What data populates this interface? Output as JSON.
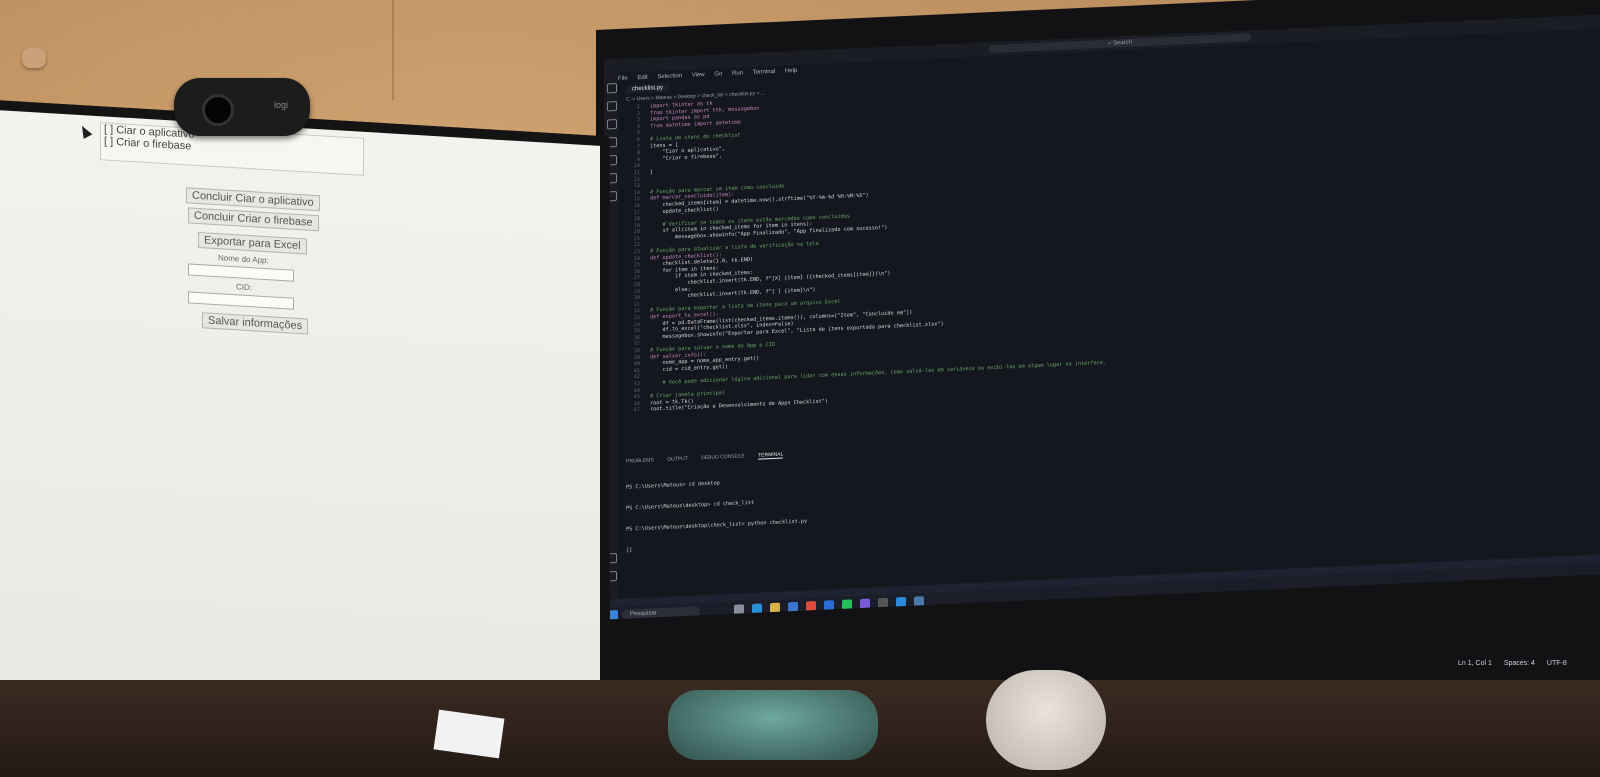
{
  "left_app": {
    "checklist_items": [
      "[ ] Ciar o aplicativo",
      "[ ] Criar o firebase"
    ],
    "btn_concluir_1": "Concluir Ciar o aplicativo",
    "btn_concluir_2": "Concluir Criar o firebase",
    "btn_exportar": "Exportar para Excel",
    "label_nome_app": "Nome do App:",
    "label_cid": "CID:",
    "btn_salvar": "Salvar informações"
  },
  "webcam": {
    "brand": "logi"
  },
  "vscode": {
    "search_placeholder": "Search",
    "menu": [
      "File",
      "Edit",
      "Selection",
      "View",
      "Go",
      "Run",
      "Terminal",
      "Help"
    ],
    "tab": "checklist.py",
    "breadcrumb": "C: > Users > Mateus > Desktop > check_list > checklist.py > ...",
    "code_lines": [
      {
        "n": "1",
        "t": "import tkinter as tk"
      },
      {
        "n": "2",
        "t": "from tkinter import ttk, messagebox"
      },
      {
        "n": "3",
        "t": "import pandas as pd"
      },
      {
        "n": "4",
        "t": "from datetime import datetime"
      },
      {
        "n": "5",
        "t": ""
      },
      {
        "n": "6",
        "t": "# Lista de itens do checklist"
      },
      {
        "n": "7",
        "t": "itens = ["
      },
      {
        "n": "8",
        "t": "    \"Ciar o aplicativo\","
      },
      {
        "n": "9",
        "t": "    \"Criar o firebase\","
      },
      {
        "n": "10",
        "t": ""
      },
      {
        "n": "11",
        "t": "]"
      },
      {
        "n": "12",
        "t": ""
      },
      {
        "n": "13",
        "t": ""
      },
      {
        "n": "14",
        "t": "# Função para marcar um item como concluído"
      },
      {
        "n": "15",
        "t": "def marcar_concluido(item):"
      },
      {
        "n": "16",
        "t": "    checked_items[item] = datetime.now().strftime(\"%Y-%m-%d %H:%M:%S\")"
      },
      {
        "n": "17",
        "t": "    update_checklist()"
      },
      {
        "n": "18",
        "t": ""
      },
      {
        "n": "19",
        "t": "    # Verificar se todos os itens estão marcados como concluídos"
      },
      {
        "n": "20",
        "t": "    if all(item in checked_items for item in itens):"
      },
      {
        "n": "21",
        "t": "        messagebox.showinfo(\"App Finalizado\", \"App finalizado com sucesso!\")"
      },
      {
        "n": "22",
        "t": ""
      },
      {
        "n": "23",
        "t": "# Função para atualizar a lista de verificação na tela"
      },
      {
        "n": "24",
        "t": "def update_checklist():"
      },
      {
        "n": "25",
        "t": "    checklist.delete(1.0, tk.END)"
      },
      {
        "n": "26",
        "t": "    for item in itens:"
      },
      {
        "n": "27",
        "t": "        if item in checked_items:"
      },
      {
        "n": "28",
        "t": "            checklist.insert(tk.END, f\"[X] {item} ({checked_items[item]})\\n\")"
      },
      {
        "n": "29",
        "t": "        else:"
      },
      {
        "n": "30",
        "t": "            checklist.insert(tk.END, f\"[ ] {item}\\n\")"
      },
      {
        "n": "31",
        "t": ""
      },
      {
        "n": "32",
        "t": "# Função para exportar a lista de itens para um arquivo Excel"
      },
      {
        "n": "33",
        "t": "def export_to_excel():"
      },
      {
        "n": "34",
        "t": "    df = pd.DataFrame(list(checked_items.items()), columns=[\"Item\", \"Concluído em\"])"
      },
      {
        "n": "35",
        "t": "    df.to_excel(\"checklist.xlsx\", index=False)"
      },
      {
        "n": "36",
        "t": "    messagebox.showinfo(\"Exportar para Excel\", \"Lista de itens exportada para checklist.xlsx\")"
      },
      {
        "n": "37",
        "t": ""
      },
      {
        "n": "38",
        "t": "# Função para salvar o nome do App e CID"
      },
      {
        "n": "39",
        "t": "def salvar_info():"
      },
      {
        "n": "40",
        "t": "    nome_app = nome_app_entry.get()"
      },
      {
        "n": "41",
        "t": "    cid = cid_entry.get()"
      },
      {
        "n": "42",
        "t": ""
      },
      {
        "n": "43",
        "t": "    # Você pode adicionar lógica adicional para lidar com essas informações, como salvá-las em variáveis ou exibi-las em algum lugar na interface."
      },
      {
        "n": "44",
        "t": ""
      },
      {
        "n": "45",
        "t": "# Criar janela principal"
      },
      {
        "n": "46",
        "t": "root = tk.Tk()"
      },
      {
        "n": "47",
        "t": "root.title(\"Criação e Desenvolvimento de Apps Checklist\")"
      }
    ],
    "panel_tabs": [
      "PROBLEMS",
      "OUTPUT",
      "DEBUG CONSOLE",
      "TERMINAL"
    ],
    "terminal_lines": [
      "PS C:\\Users\\Mateus> cd desktop",
      "PS C:\\Users\\Mateus\\desktop> cd check_list",
      "PS C:\\Users\\Mateus\\desktop\\check_list> python checklist.py",
      "[]"
    ],
    "taskbar_search": "Pesquisar",
    "status": [
      "Ln 1, Col 1",
      "Spaces: 4",
      "UTF-8"
    ]
  }
}
